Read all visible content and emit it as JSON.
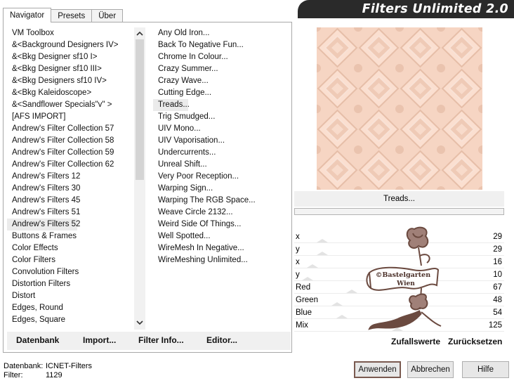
{
  "tabs": [
    "Navigator",
    "Presets",
    "Über"
  ],
  "categories": {
    "items": [
      "VM Toolbox",
      "&<Background Designers IV>",
      "&<Bkg Designer sf10 I>",
      "&<Bkg Designer sf10 III>",
      "&<Bkg Designers sf10 IV>",
      "&<Bkg Kaleidoscope>",
      "&<Sandflower Specials\"v\" >",
      "[AFS IMPORT]",
      "Andrew's Filter Collection 57",
      "Andrew's Filter Collection 58",
      "Andrew's Filter Collection 59",
      "Andrew's Filter Collection 62",
      "Andrew's Filters 12",
      "Andrew's Filters 30",
      "Andrew's Filters 45",
      "Andrew's Filters 51",
      "Andrew's Filters 52",
      "Buttons & Frames",
      "Color Effects",
      "Color Filters",
      "Convolution Filters",
      "Distortion Filters",
      "Distort",
      "Edges, Round",
      "Edges, Square",
      "..."
    ],
    "selected": "Andrew's Filters 52",
    "scroll_up_icon": "chevron-up-icon",
    "scroll_down_icon": "chevron-down-icon"
  },
  "filters": {
    "items": [
      "Any Old Iron...",
      "Back To Negative Fun...",
      "Chrome In Colour...",
      "Crazy Summer...",
      "Crazy Wave...",
      "Cutting Edge...",
      "Treads...",
      "Trig Smudged...",
      "UIV Mono...",
      "UIV Vaporisation...",
      "Undercurrents...",
      "Unreal Shift...",
      "Very Poor Reception...",
      "Warping Sign...",
      "Warping The RGB Space...",
      "Weave Circle 2132...",
      "Weird Side Of Things...",
      "Well Spotted...",
      "WireMesh In Negative...",
      "WireMeshing Unlimited..."
    ],
    "selected": "Treads..."
  },
  "panel_buttons": {
    "datenbank": "Datenbank",
    "import": "Import...",
    "filter_info": "Filter Info...",
    "editor": "Editor..."
  },
  "header": {
    "title": "Filters Unlimited 2.0"
  },
  "preview": {
    "filter_name": "Treads...",
    "progress": 0
  },
  "params": [
    {
      "label": "x",
      "value": "29",
      "slider": 0.114
    },
    {
      "label": "y",
      "value": "29",
      "slider": 0.114
    },
    {
      "label": "x",
      "value": "16",
      "slider": 0.063
    },
    {
      "label": "y",
      "value": "10",
      "slider": 0.039
    },
    {
      "label": "Red",
      "value": "67",
      "slider": 0.263
    },
    {
      "label": "Green",
      "value": "48",
      "slider": 0.188
    },
    {
      "label": "Blue",
      "value": "54",
      "slider": 0.212
    },
    {
      "label": "Mix",
      "value": "125",
      "slider": 0.49
    }
  ],
  "watermark": {
    "line1": "©Bastelgarten",
    "line2": "Wien"
  },
  "right_buttons": {
    "randomize": "Zufallswerte",
    "reset": "Zurücksetzen"
  },
  "footer": {
    "db_label": "Datenbank:",
    "db_value": "ICNET-Filters",
    "filter_label": "Filter:",
    "filter_value": "1129",
    "apply": "Anwenden",
    "cancel": "Abbrechen",
    "help": "Hilfe"
  },
  "colors": {
    "preview_base": "#f6d5c3",
    "preview_dark": "#e8c0aa",
    "preview_light": "#fde6da",
    "banner": "#2a2a2a",
    "default_button_border": "#7a5a50",
    "stamp": "#6b4a40"
  }
}
